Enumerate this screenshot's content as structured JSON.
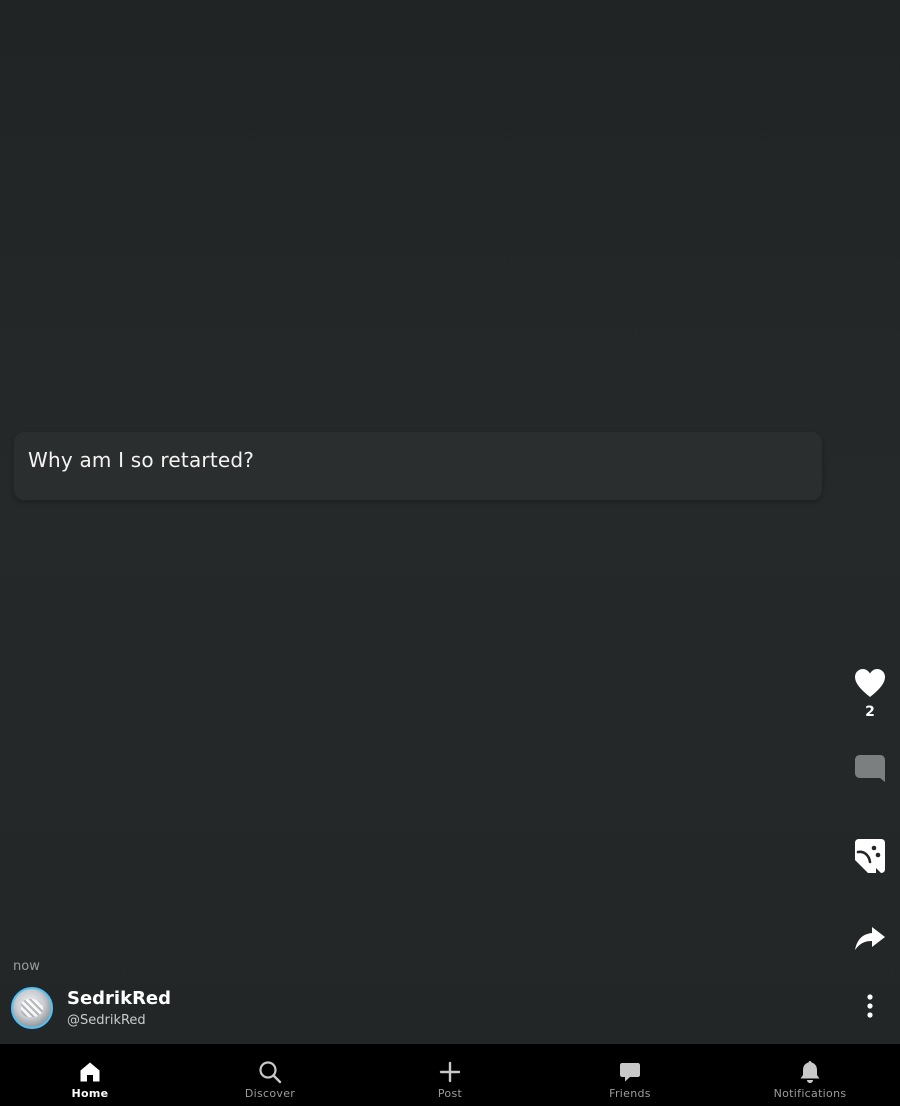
{
  "post": {
    "text": "Why am I so retarted?",
    "timestamp": "now",
    "author": {
      "display_name": "SedrikRed",
      "handle": "@SedrikRed"
    }
  },
  "actions": {
    "like": {
      "icon": "heart-icon",
      "count": "2"
    },
    "comment": {
      "icon": "comment-icon"
    },
    "remix": {
      "icon": "remix-icon"
    },
    "share": {
      "icon": "share-icon"
    },
    "more": {
      "icon": "more-vertical-icon"
    }
  },
  "bottom_nav": {
    "items": [
      {
        "label": "Home",
        "icon": "home-icon",
        "active": true
      },
      {
        "label": "Discover",
        "icon": "search-icon",
        "active": false
      },
      {
        "label": "Post",
        "icon": "plus-icon",
        "active": false
      },
      {
        "label": "Friends",
        "icon": "chat-icon",
        "active": false
      },
      {
        "label": "Notifications",
        "icon": "bell-icon",
        "active": false
      }
    ]
  },
  "colors": {
    "background": "#222626",
    "card": "#2a2e2e",
    "nav_background": "#000000",
    "avatar_ring": "#4fc3f7"
  }
}
